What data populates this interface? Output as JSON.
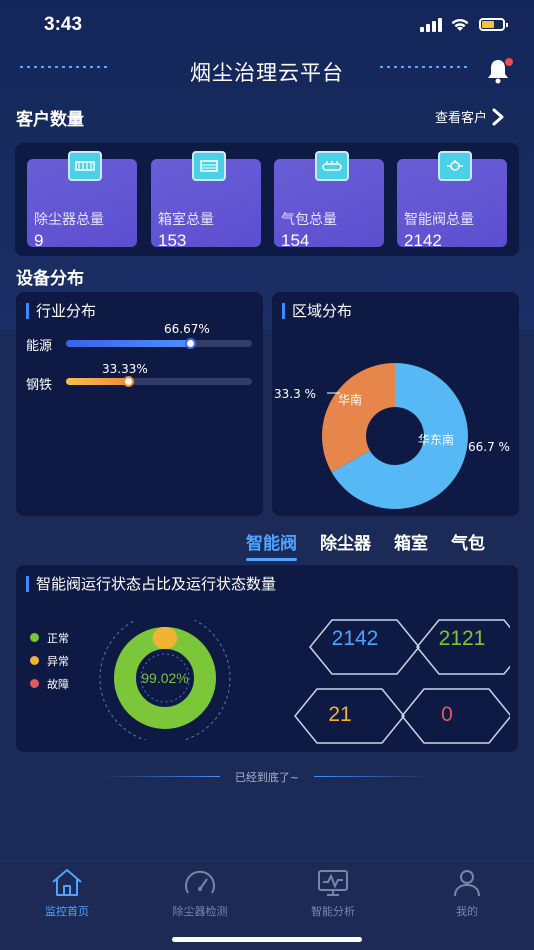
{
  "status_bar": {
    "time": "3:43"
  },
  "header": {
    "title": "烟尘治理云平台"
  },
  "customers": {
    "title": "客户数量",
    "view_link": "查看客户",
    "cards": [
      {
        "label": "除尘器总量",
        "value": "9",
        "icon": "dust-collector-icon"
      },
      {
        "label": "箱室总量",
        "value": "153",
        "icon": "chamber-icon"
      },
      {
        "label": "气包总量",
        "value": "154",
        "icon": "air-bag-icon"
      },
      {
        "label": "智能阀总量",
        "value": "2142",
        "icon": "smart-valve-icon"
      }
    ]
  },
  "distribution": {
    "title": "设备分布",
    "industry": {
      "title": "行业分布",
      "rows": [
        {
          "label": "能源",
          "percent": 66.67,
          "percent_text": "66.67%",
          "color_from": "#3a63e8",
          "color_to": "#4f8dff"
        },
        {
          "label": "钢铁",
          "percent": 33.33,
          "percent_text": "33.33%",
          "color_from": "#f5c24a",
          "color_to": "#ef8a3c"
        }
      ]
    },
    "region": {
      "title": "区域分布",
      "slices": [
        {
          "label": "华东南",
          "percent": 66.7,
          "percent_text": "66.7 %",
          "color": "#56b8f5"
        },
        {
          "label": "华南",
          "percent": 33.3,
          "percent_text": "33.3 %",
          "color": "#e6864a"
        }
      ]
    }
  },
  "tabs": [
    "智能阀",
    "除尘器",
    "箱室",
    "气包"
  ],
  "active_tab": "智能阀",
  "valve_status": {
    "title": "智能阀运行状态占比及运行状态数量",
    "legend": [
      {
        "label": "正常",
        "color": "#7cc63a"
      },
      {
        "label": "异常",
        "color": "#f2b234"
      },
      {
        "label": "故障",
        "color": "#e05a5a"
      }
    ],
    "ring_center": "99.02%",
    "normal_fraction": 0.9902,
    "counts": [
      {
        "value": "2142",
        "color": "#4da3ff"
      },
      {
        "value": "2121",
        "color": "#7cc63a"
      },
      {
        "value": "21",
        "color": "#f2b234"
      },
      {
        "value": "0",
        "color": "#e05a5a"
      }
    ]
  },
  "end_text": "已经到底了~",
  "nav": [
    {
      "label": "监控首页",
      "icon": "home-icon",
      "active": true
    },
    {
      "label": "除尘器检测",
      "icon": "gauge-icon",
      "active": false
    },
    {
      "label": "智能分析",
      "icon": "monitor-chart-icon",
      "active": false
    },
    {
      "label": "我的",
      "icon": "user-icon",
      "active": false
    }
  ]
}
